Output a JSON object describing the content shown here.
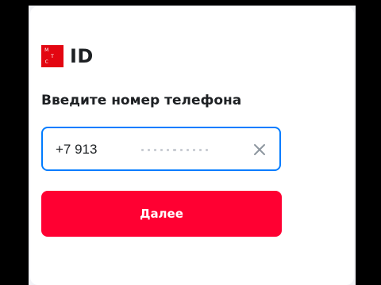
{
  "logo": {
    "mark_letters": [
      "М",
      "Т",
      "С"
    ],
    "text": "ID",
    "brand_color": "#e30611"
  },
  "form": {
    "title": "Введите номер телефона",
    "phone_value": "+7 913",
    "focus_color": "#007cff",
    "clear_icon": "close-icon",
    "submit_label": "Далее",
    "submit_color": "#ff0032"
  }
}
